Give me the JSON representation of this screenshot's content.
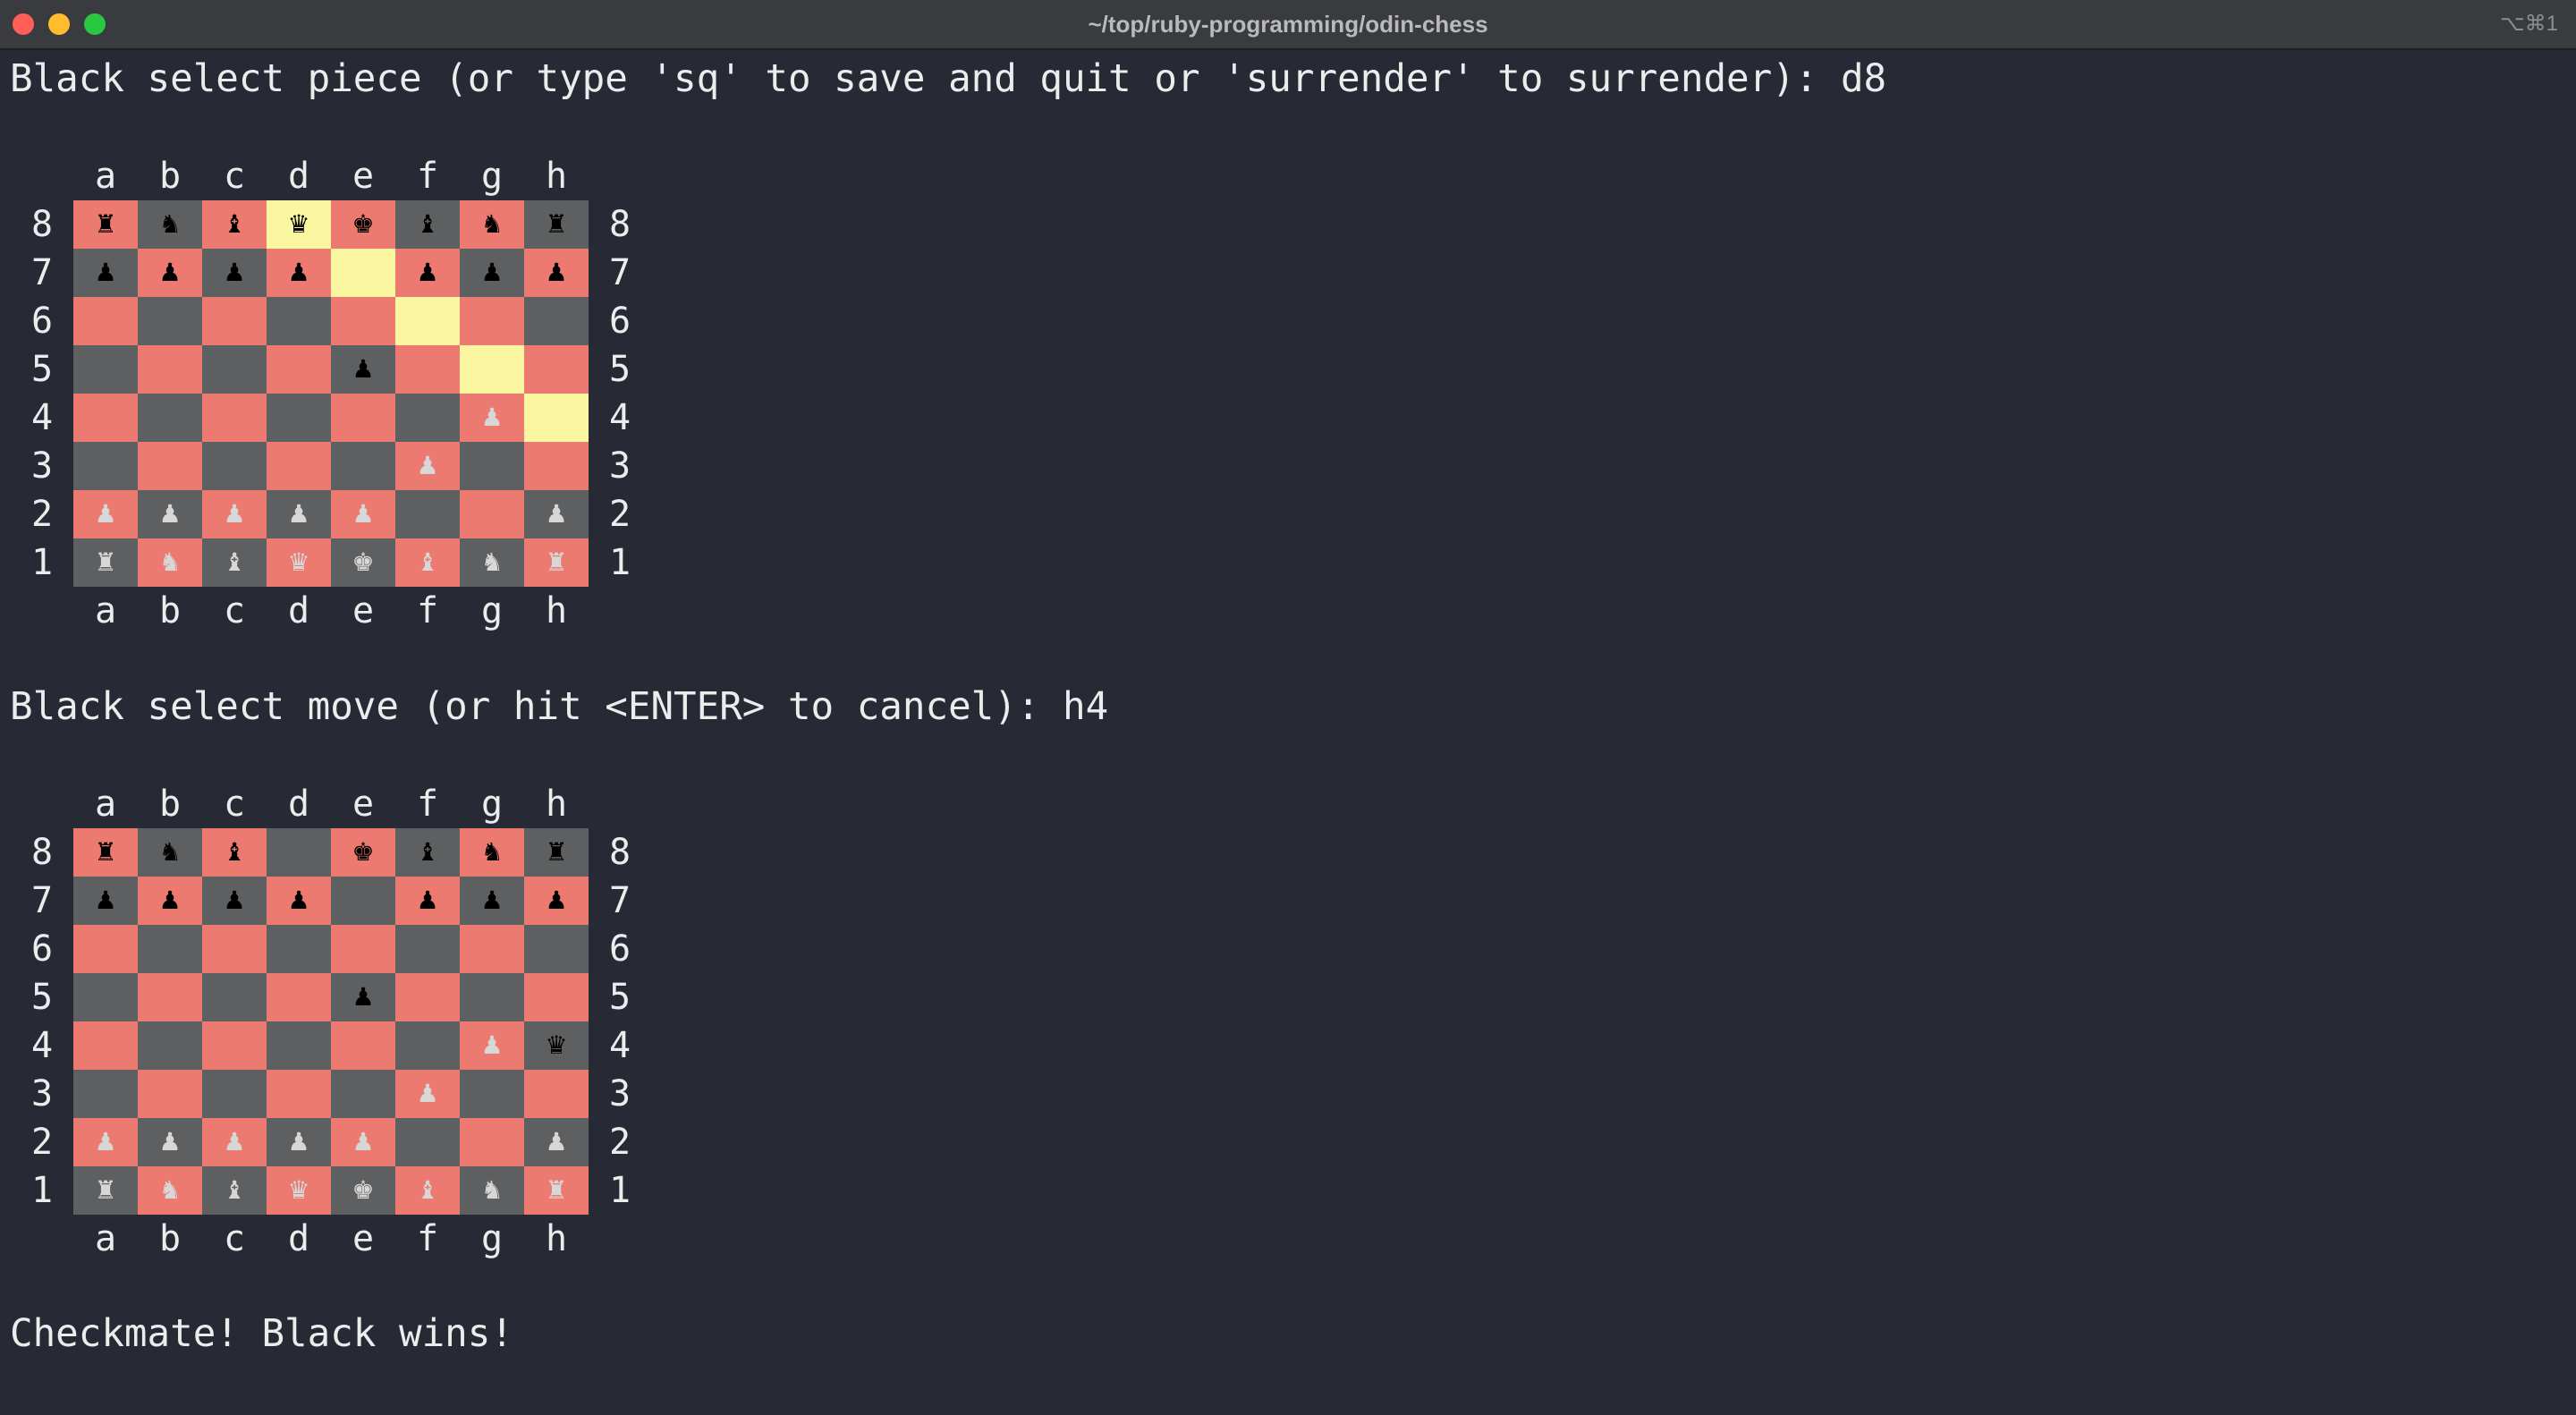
{
  "window": {
    "title": "~/top/ruby-programming/odin-chess",
    "shortcut": "⌥⌘1"
  },
  "terminal": {
    "prompt1": "Black select piece (or type 'sq' to save and quit or 'surrender' to surrender): d8",
    "prompt2": "Black select move (or hit <ENTER> to cancel): h4",
    "result": "Checkmate! Black wins!"
  },
  "files": [
    "a",
    "b",
    "c",
    "d",
    "e",
    "f",
    "g",
    "h"
  ],
  "ranks": [
    "8",
    "7",
    "6",
    "5",
    "4",
    "3",
    "2",
    "1"
  ],
  "colors": {
    "light_square": "#ec7a70",
    "dark_square": "#5e5f61",
    "highlight": "#fbf7a1",
    "background": "#272a35"
  },
  "board1": {
    "pieces": [
      [
        "♜b",
        "♞b",
        "♝b",
        "♛b",
        "♚b",
        "♝b",
        "♞b",
        "♜b"
      ],
      [
        "♟b",
        "♟b",
        "♟b",
        "♟b",
        "",
        "♟b",
        "♟b",
        "♟b"
      ],
      [
        "",
        "",
        "",
        "",
        "",
        "",
        "",
        ""
      ],
      [
        "",
        "",
        "",
        "",
        "♟b",
        "",
        "",
        ""
      ],
      [
        "",
        "",
        "",
        "",
        "",
        "",
        "♟w",
        ""
      ],
      [
        "",
        "",
        "",
        "",
        "",
        "♟w",
        "",
        ""
      ],
      [
        "♟w",
        "♟w",
        "♟w",
        "♟w",
        "♟w",
        "",
        "",
        "♟w"
      ],
      [
        "♜w",
        "♞w",
        "♝w",
        "♛w",
        "♚w",
        "♝w",
        "♞w",
        "♜w"
      ]
    ],
    "highlights": [
      "d8",
      "e7",
      "f6",
      "g5",
      "h4"
    ]
  },
  "board2": {
    "pieces": [
      [
        "♜b",
        "♞b",
        "♝b",
        "",
        "♚b",
        "♝b",
        "♞b",
        "♜b"
      ],
      [
        "♟b",
        "♟b",
        "♟b",
        "♟b",
        "",
        "♟b",
        "♟b",
        "♟b"
      ],
      [
        "",
        "",
        "",
        "",
        "",
        "",
        "",
        ""
      ],
      [
        "",
        "",
        "",
        "",
        "♟b",
        "",
        "",
        ""
      ],
      [
        "",
        "",
        "",
        "",
        "",
        "",
        "♟w",
        "♛b"
      ],
      [
        "",
        "",
        "",
        "",
        "",
        "♟w",
        "",
        ""
      ],
      [
        "♟w",
        "♟w",
        "♟w",
        "♟w",
        "♟w",
        "",
        "",
        "♟w"
      ],
      [
        "♜w",
        "♞w",
        "♝w",
        "♛w",
        "♚w",
        "♝w",
        "♞w",
        "♜w"
      ]
    ],
    "highlights": []
  }
}
